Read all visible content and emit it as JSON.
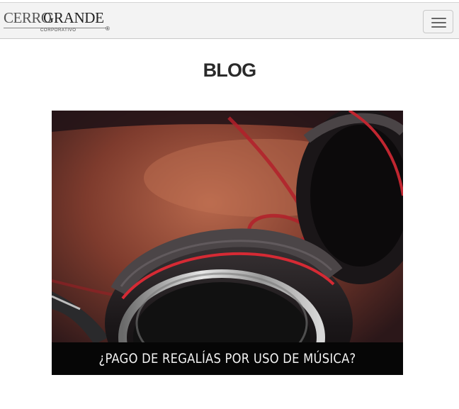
{
  "navbar": {
    "logo": {
      "word1": "CERRO",
      "word2": "GRANDE",
      "subtitle": "CORPORATIVO",
      "mark": "®"
    },
    "menu_toggle_icon": "hamburger-icon"
  },
  "main": {
    "title": "BLOG",
    "posts": [
      {
        "title": "¿PAGO DE REGALÍAS POR USO DE MÚSICA?",
        "image": "headphones-photo"
      }
    ]
  },
  "colors": {
    "navbar_bg": "#f3f3f3",
    "caption_bg": "#060606",
    "caption_text": "#f2f2f2",
    "title_text": "#2a2a2a"
  }
}
